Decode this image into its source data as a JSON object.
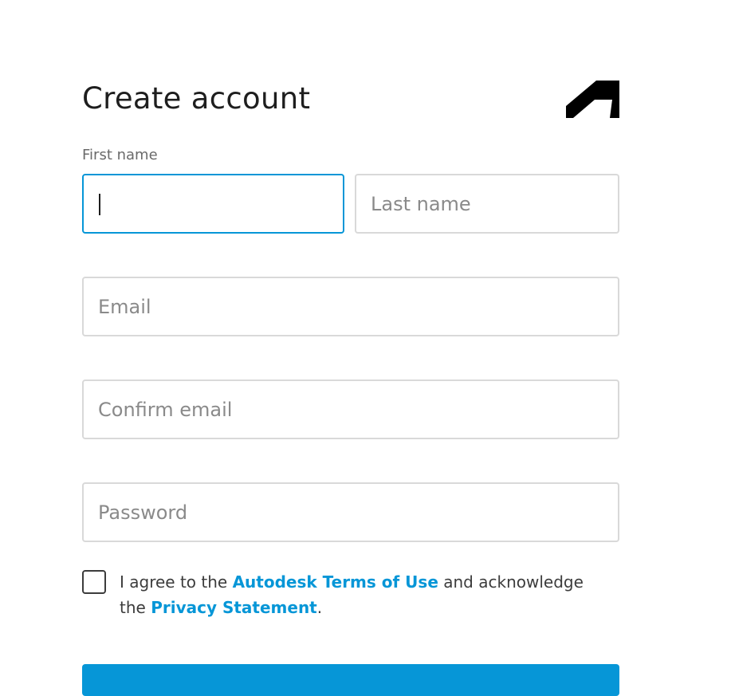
{
  "form": {
    "title": "Create account",
    "first_name_label": "First name",
    "first_name_value": "",
    "last_name_placeholder": "Last name",
    "email_placeholder": "Email",
    "confirm_email_placeholder": "Confirm email",
    "password_placeholder": "Password",
    "agreement": {
      "checked": false,
      "text_1": "I agree to the ",
      "terms_link": "Autodesk Terms of Use",
      "text_2": " and acknowledge the ",
      "privacy_link": "Privacy Statement",
      "text_3": "."
    }
  },
  "brand": {
    "logo_icon": "autodesk-logo-icon",
    "accent_color": "#0696d7",
    "text_color": "#1e1e1e"
  }
}
